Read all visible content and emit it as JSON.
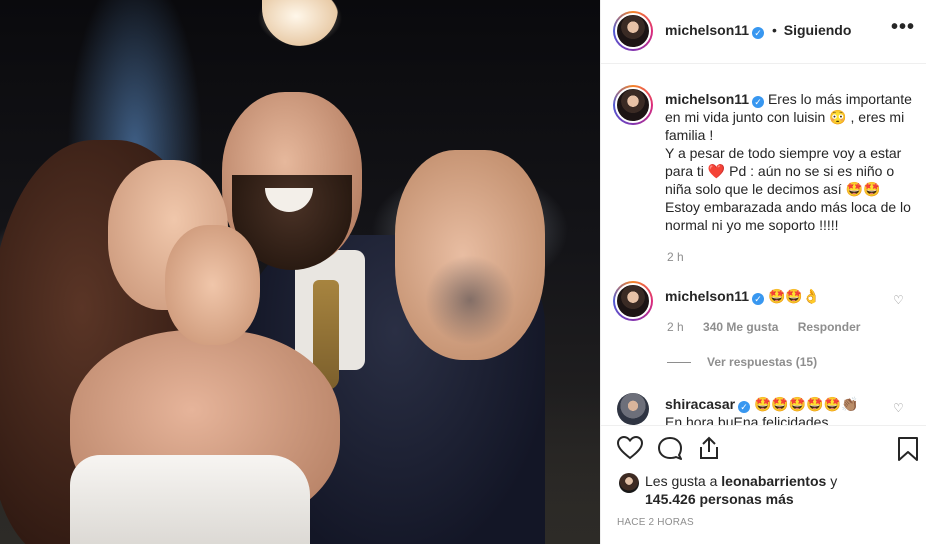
{
  "post": {
    "author": "michelson11",
    "follow_status": "Siguiendo",
    "header_separator": "•"
  },
  "caption": {
    "username": "michelson11",
    "lines": [
      "Eres lo más importante en mi vida junto con luisin 😳 , eres mi familia !",
      "Y a pesar de todo siempre voy a estar para ti ❤️ Pd : aún no se si es niño o niña solo que le decimos así 🤩🤩 Estoy embarazada ando más loca de lo normal ni yo me soporto !!!!!"
    ],
    "time": "2 h"
  },
  "comments": [
    {
      "username": "michelson11",
      "text": "🤩🤩👌",
      "time": "2 h",
      "likes": "340 Me gusta",
      "reply_label": "Responder",
      "view_replies": "Ver respuestas (15)"
    },
    {
      "username": "shiracasar",
      "text": "🤩🤩🤩🤩🤩👏🏽",
      "second_line": "En hora buEna felicidades"
    }
  ],
  "likes": {
    "prefix": "Les gusta a",
    "user": "leonabarrientos",
    "middle": "y",
    "count": "145.426 personas más"
  },
  "time_ago": "HACE 2 HORAS",
  "icons": {
    "like": "heart-icon",
    "comment": "comment-icon",
    "share": "share-icon",
    "save": "bookmark-icon",
    "more": "more-options-icon"
  },
  "colors": {
    "verified": "#3897f0",
    "text": "#262626",
    "muted": "#8e8e8e"
  }
}
